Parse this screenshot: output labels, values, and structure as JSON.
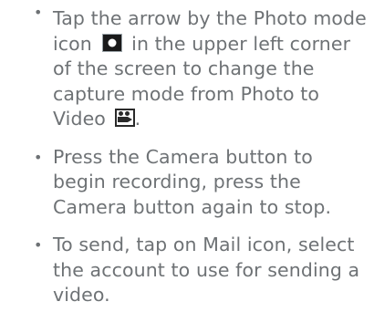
{
  "instructions": {
    "items": [
      {
        "text_before_icon": "Tap the arrow by the Photo mode icon",
        "icon_1": "photo-mode-icon",
        "text_after_icon": "in the upper left corner of the screen to change the capture mode from Photo to Video",
        "icon_2": "video-mode-icon",
        "end": "."
      },
      {
        "text": "Press the Camera button to begin recording, press the Camera button again to stop."
      },
      {
        "text": "To send, tap on Mail icon, select the account to use for sending a video."
      }
    ]
  },
  "colors": {
    "text": "#6e7275",
    "icon_dark": "#1a1a1a"
  }
}
